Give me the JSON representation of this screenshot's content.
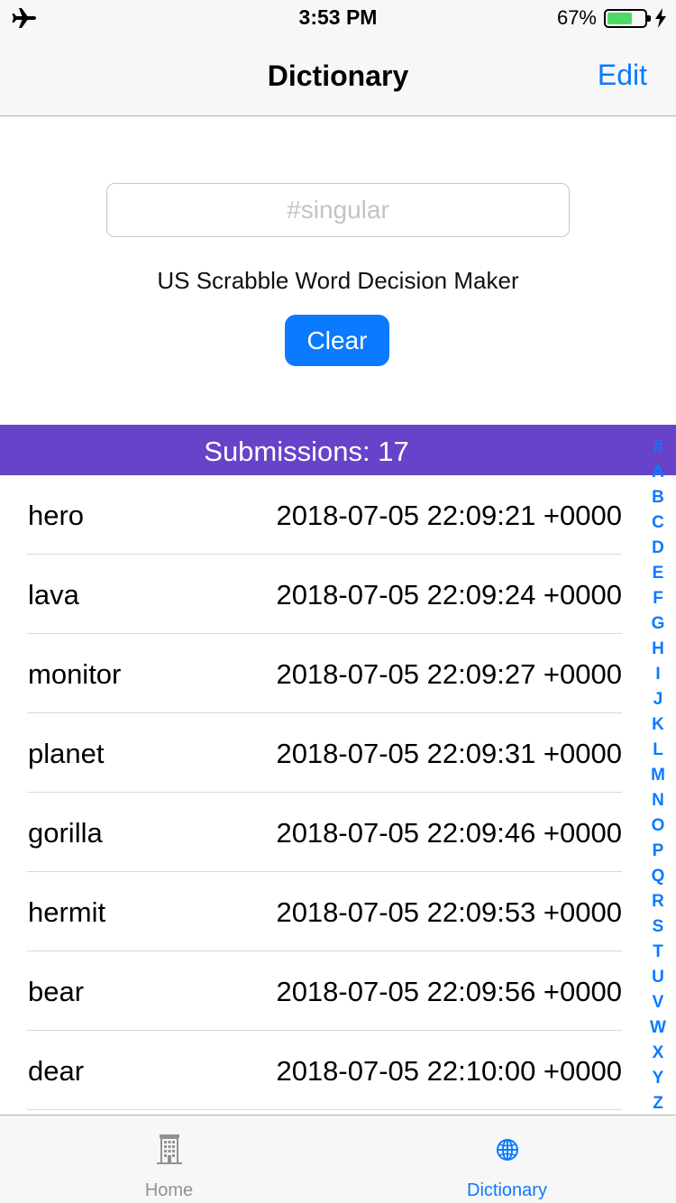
{
  "status_bar": {
    "time": "3:53 PM",
    "battery_percent": "67%",
    "battery_level": 0.67
  },
  "nav": {
    "title": "Dictionary",
    "edit_label": "Edit"
  },
  "search": {
    "placeholder": "#singular",
    "value": ""
  },
  "subtitle": "US Scrabble Word Decision Maker",
  "clear_label": "Clear",
  "section_header": "Submissions: 17",
  "rows": [
    {
      "word": "hero",
      "date": "2018-07-05 22:09:21 +0000"
    },
    {
      "word": "lava",
      "date": "2018-07-05 22:09:24 +0000"
    },
    {
      "word": "monitor",
      "date": "2018-07-05 22:09:27 +0000"
    },
    {
      "word": "planet",
      "date": "2018-07-05 22:09:31 +0000"
    },
    {
      "word": "gorilla",
      "date": "2018-07-05 22:09:46 +0000"
    },
    {
      "word": "hermit",
      "date": "2018-07-05 22:09:53 +0000"
    },
    {
      "word": "bear",
      "date": "2018-07-05 22:09:56 +0000"
    },
    {
      "word": "dear",
      "date": "2018-07-05 22:10:00 +0000"
    }
  ],
  "index_letters": [
    "#",
    "A",
    "B",
    "C",
    "D",
    "E",
    "F",
    "G",
    "H",
    "I",
    "J",
    "K",
    "L",
    "M",
    "N",
    "O",
    "P",
    "Q",
    "R",
    "S",
    "T",
    "U",
    "V",
    "W",
    "X",
    "Y",
    "Z"
  ],
  "tabs": [
    {
      "label": "Home",
      "icon": "building-icon",
      "selected": false
    },
    {
      "label": "Dictionary",
      "icon": "globe-icon",
      "selected": true
    }
  ],
  "colors": {
    "accent": "#0a7aff",
    "header": "#6643c8",
    "battery": "#4cd964"
  }
}
